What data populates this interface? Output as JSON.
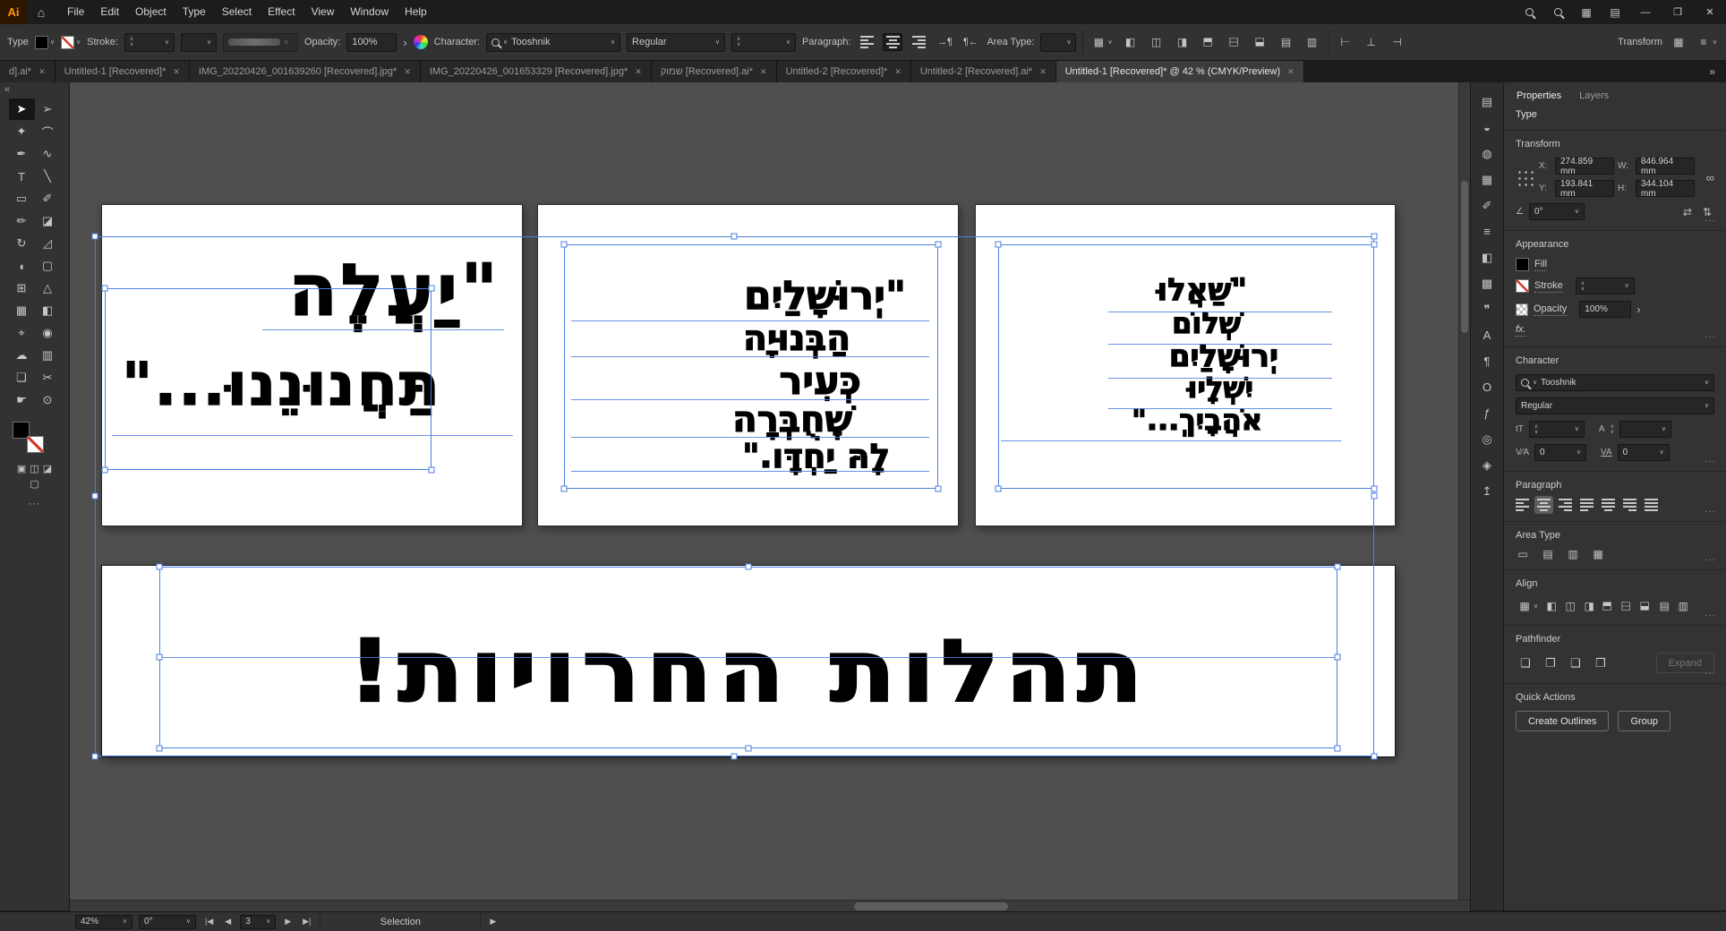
{
  "titlebar": {
    "logo": "Ai",
    "menus": [
      "File",
      "Edit",
      "Object",
      "Type",
      "Select",
      "Effect",
      "View",
      "Window",
      "Help"
    ]
  },
  "icons": {
    "home": "⌂",
    "minimize": "—",
    "restore": "❐",
    "close": "✕",
    "tab_close": "✕",
    "overflow": "»",
    "collapse": "«",
    "dropdown": "∨",
    "stepper_up": "∧",
    "stepper_down": "∨",
    "submenu": "›",
    "more": "···",
    "grid": "▦",
    "workspace": "▤",
    "menu_lines": "≡",
    "link": "∞",
    "angle": "∠",
    "flip_h": "⇄",
    "flip_v": "⇅",
    "fx": "fx.",
    "size": "tT",
    "leading": "A",
    "kerning": "V⁄A",
    "tracking": "VA",
    "para_ltr": "→¶",
    "para_rtl": "¶←",
    "draw_normal": "▣",
    "draw_behind": "◫",
    "draw_inside": "◪",
    "screen_mode": "▢",
    "nav_first": "|◀",
    "nav_prev": "◀",
    "nav_next": "▶",
    "nav_last": "▶|",
    "play": "▶"
  },
  "control_bar": {
    "selection_type": "Type",
    "stroke_label": "Stroke:",
    "opacity_label": "Opacity:",
    "opacity_value": "100%",
    "character_label": "Character:",
    "font_name": "Tooshnik",
    "font_style": "Regular",
    "paragraph_label": "Paragraph:",
    "area_type_label": "Area Type:",
    "transform_label": "Transform"
  },
  "document_tabs": {
    "tabs": [
      {
        "label": "d].ai*"
      },
      {
        "label": "Untitled-1 [Recovered]*"
      },
      {
        "label": "IMG_20220426_001639260 [Recovered].jpg*"
      },
      {
        "label": "IMG_20220426_001653329 [Recovered].jpg*"
      },
      {
        "label": "שמוק [Recovered].ai*"
      },
      {
        "label": "Untitled-2 [Recovered]*"
      },
      {
        "label": "Untitled-2 [Recovered].ai*"
      },
      {
        "label": "Untitled-1 [Recovered]* @ 42 % (CMYK/Preview)",
        "active": true
      }
    ]
  },
  "toolbar": {
    "tools": [
      {
        "name": "selection-tool",
        "glyph": "➤",
        "active": true
      },
      {
        "name": "direct-selection-tool",
        "glyph": "➢"
      },
      {
        "name": "magic-wand-tool",
        "glyph": "✦"
      },
      {
        "name": "lasso-tool",
        "glyph": "⌒"
      },
      {
        "name": "pen-tool",
        "glyph": "✒"
      },
      {
        "name": "curvature-tool",
        "glyph": "∿"
      },
      {
        "name": "type-tool",
        "glyph": "T"
      },
      {
        "name": "line-segment-tool",
        "glyph": "╲"
      },
      {
        "name": "rectangle-tool",
        "glyph": "▭"
      },
      {
        "name": "paintbrush-tool",
        "glyph": "✐"
      },
      {
        "name": "pencil-tool",
        "glyph": "✏"
      },
      {
        "name": "eraser-tool",
        "glyph": "◪"
      },
      {
        "name": "rotate-tool",
        "glyph": "↻"
      },
      {
        "name": "scale-tool",
        "glyph": "◿"
      },
      {
        "name": "width-tool",
        "glyph": "◖"
      },
      {
        "name": "free-transform-tool",
        "glyph": "▢"
      },
      {
        "name": "shape-builder-tool",
        "glyph": "⊞"
      },
      {
        "name": "perspective-grid-tool",
        "glyph": "△"
      },
      {
        "name": "mesh-tool",
        "glyph": "▦"
      },
      {
        "name": "gradient-tool",
        "glyph": "◧"
      },
      {
        "name": "eyedropper-tool",
        "glyph": "⌖"
      },
      {
        "name": "blend-tool",
        "glyph": "◉"
      },
      {
        "name": "symbol-sprayer-tool",
        "glyph": "☁"
      },
      {
        "name": "column-graph-tool",
        "glyph": "▥"
      },
      {
        "name": "artboard-tool",
        "glyph": "❏"
      },
      {
        "name": "slice-tool",
        "glyph": "✂"
      },
      {
        "name": "hand-tool",
        "glyph": "☛"
      },
      {
        "name": "zoom-tool",
        "glyph": "⊙"
      }
    ]
  },
  "icon_sets": {
    "cb_paragraph": [
      {
        "name": "align-left-icon",
        "cls": "pic-l"
      },
      {
        "name": "align-center-icon",
        "cls": "pic-c",
        "active": true
      },
      {
        "name": "align-right-icon",
        "cls": "pic-r"
      }
    ],
    "paragraph": [
      {
        "name": "align-left-icon",
        "cls": "pic-l"
      },
      {
        "name": "align-center-icon",
        "cls": "pic-c",
        "active": true
      },
      {
        "name": "align-right-icon",
        "cls": "pic-r"
      },
      {
        "name": "justify-left-icon",
        "cls": "pic-jl"
      },
      {
        "name": "justify-center-icon",
        "cls": "pic-jc"
      },
      {
        "name": "justify-right-icon",
        "cls": "pic-jr"
      },
      {
        "name": "justify-all-icon",
        "cls": "pic-ja"
      }
    ],
    "align": [
      {
        "name": "align-horizontal-left-icon",
        "glyph": "◧"
      },
      {
        "name": "align-horizontal-center-icon",
        "glyph": "◫"
      },
      {
        "name": "align-horizontal-right-icon",
        "glyph": "◨"
      },
      {
        "name": "align-vertical-top-icon",
        "glyph": "◧",
        "cls": "rot"
      },
      {
        "name": "align-vertical-center-icon",
        "glyph": "◫",
        "cls": "rot"
      },
      {
        "name": "align-vertical-bottom-icon",
        "glyph": "◨",
        "cls": "rot"
      },
      {
        "name": "distribute-vertical-icon",
        "glyph": "▤"
      },
      {
        "name": "distribute-horizontal-icon",
        "glyph": "▥"
      }
    ],
    "distribute_spacing": [
      {
        "name": "distribute-spacing-left-icon",
        "glyph": "⊢"
      },
      {
        "name": "distribute-spacing-center-icon",
        "glyph": "⊥"
      },
      {
        "name": "distribute-spacing-right-icon",
        "glyph": "⊣"
      }
    ],
    "area_type": [
      {
        "name": "area-type-auto-icon",
        "glyph": "▭"
      },
      {
        "name": "area-type-rows-icon",
        "glyph": "▤"
      },
      {
        "name": "area-type-columns-icon",
        "glyph": "▥"
      },
      {
        "name": "area-type-grid-icon",
        "glyph": "▦"
      }
    ],
    "pathfinder": [
      {
        "name": "pathfinder-unite-icon",
        "glyph": "❏"
      },
      {
        "name": "pathfinder-minus-front-icon",
        "glyph": "❐"
      },
      {
        "name": "pathfinder-intersect-icon",
        "glyph": "❑"
      },
      {
        "name": "pathfinder-exclude-icon",
        "glyph": "❒"
      }
    ]
  },
  "panel_strip": {
    "icons": [
      {
        "name": "libraries-icon",
        "glyph": "▤"
      },
      {
        "name": "color-icon",
        "glyph": "◒"
      },
      {
        "name": "color-guide-icon",
        "glyph": "◍"
      },
      {
        "name": "swatches-icon",
        "glyph": "▦"
      },
      {
        "name": "brushes-icon",
        "glyph": "✐"
      },
      {
        "name": "stroke-icon",
        "glyph": "≡"
      },
      {
        "name": "gradient-icon",
        "glyph": "◧"
      },
      {
        "name": "transparency-icon",
        "glyph": "▩"
      },
      {
        "name": "comments-icon",
        "glyph": "❞"
      },
      {
        "name": "character-icon",
        "glyph": "A"
      },
      {
        "name": "paragraph-icon",
        "glyph": "¶"
      },
      {
        "name": "opentype-icon",
        "glyph": "O"
      },
      {
        "name": "glyphs-icon",
        "glyph": "ƒ"
      },
      {
        "name": "appearance-icon",
        "glyph": "◎"
      },
      {
        "name": "graphic-styles-icon",
        "glyph": "◈"
      },
      {
        "name": "asset-export-icon",
        "glyph": "↥"
      }
    ]
  },
  "canvas": {
    "artboards": [
      {
        "name": "artboard-1",
        "lines": [
          "\"יַעֲלֶה",
          "תַּחֲנוּנֵנוּ...\""
        ]
      },
      {
        "name": "artboard-2",
        "lines": [
          "\"יְרוּשָׁלַיִם",
          "הַבְּנוּיָה",
          "כְּעִיר",
          "שֶׁחֻבְּרָה",
          "לָהּ יַחְדָּו.\""
        ]
      },
      {
        "name": "artboard-3",
        "lines": [
          "\"שַׁאֲלוּ",
          "שְׁלוֹם",
          "יְרוּשָׁלַיִם",
          "יִשְׁלָיוּ",
          "אֹהֲבָיִךְ...\""
        ]
      },
      {
        "name": "artboard-4",
        "lines": [
          "תהלות החרויות!"
        ]
      }
    ]
  },
  "properties_panel": {
    "tabs": [
      {
        "label": "Properties",
        "active": true
      },
      {
        "label": "Layers"
      }
    ],
    "selection_type": "Type",
    "transform": {
      "title": "Transform",
      "x_label": "X:",
      "x_value": "274.859 mm",
      "y_label": "Y:",
      "y_value": "193.841 mm",
      "w_label": "W:",
      "w_value": "846.964 mm",
      "h_label": "H:",
      "h_value": "344.104 mm",
      "angle_value": "0°"
    },
    "appearance": {
      "title": "Appearance",
      "fill_label": "Fill",
      "stroke_label": "Stroke",
      "opacity_label": "Opacity",
      "opacity_value": "100%"
    },
    "character": {
      "title": "Character",
      "font_name": "Tooshnik",
      "font_style": "Regular",
      "kerning_value": "0",
      "tracking_value": "0"
    },
    "paragraph": {
      "title": "Paragraph"
    },
    "area_type": {
      "title": "Area Type"
    },
    "align": {
      "title": "Align"
    },
    "pathfinder": {
      "title": "Pathfinder",
      "expand_label": "Expand"
    },
    "quick_actions": {
      "title": "Quick Actions",
      "create_outlines_label": "Create Outlines",
      "group_label": "Group"
    }
  },
  "status_bar": {
    "zoom_value": "42%",
    "rotation_value": "0°",
    "artboard_nav_value": "3",
    "status_label": "Selection"
  }
}
